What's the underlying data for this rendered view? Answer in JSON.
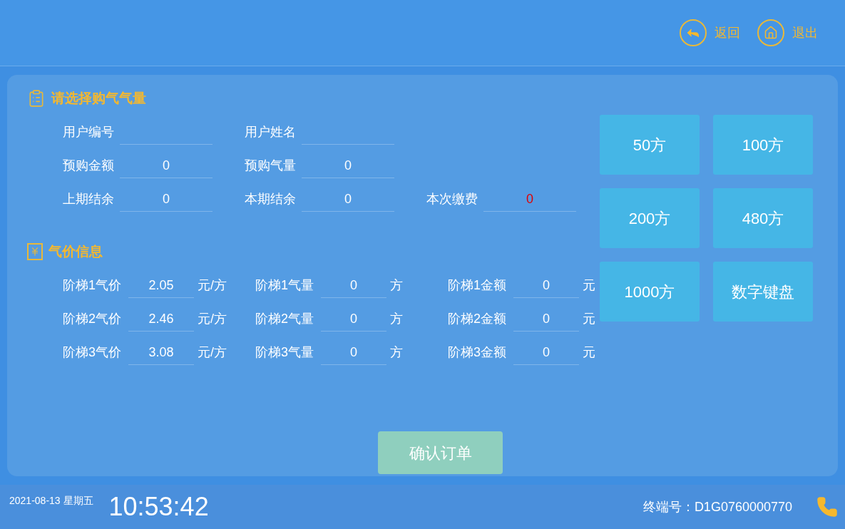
{
  "header": {
    "actions": [
      {
        "kind": "back",
        "label": "返回"
      },
      {
        "kind": "home",
        "label": "退出"
      }
    ]
  },
  "purchase": {
    "title": "请选择购气气量",
    "rows": [
      [
        {
          "label": "用户编号"
        },
        {
          "label": "用户姓名"
        }
      ],
      [
        {
          "label": "预购金额",
          "value": "0",
          "alert": false
        },
        {
          "label": "预购气量",
          "value": "0",
          "alert": false
        }
      ],
      [
        {
          "label": "上期结余",
          "value": "0",
          "alert": false
        },
        {
          "label": "本期结余",
          "value": "0",
          "alert": false
        },
        {
          "label": "本次缴费",
          "value": "0",
          "alert": true
        }
      ]
    ]
  },
  "price_info": {
    "title": "气价信息",
    "rows": [
      [
        {
          "label": "阶梯1气价",
          "value": "2.05",
          "unit": "元/方"
        },
        {
          "label": "阶梯1气量",
          "value": "0",
          "unit": "方"
        },
        {
          "label": "阶梯1金额",
          "value": "0",
          "unit": "元"
        }
      ],
      [
        {
          "label": "阶梯2气价",
          "value": "2.46",
          "unit": "元/方"
        },
        {
          "label": "阶梯2气量",
          "value": "0",
          "unit": "方"
        },
        {
          "label": "阶梯2金额",
          "value": "0",
          "unit": "元"
        }
      ],
      [
        {
          "label": "阶梯3气价",
          "value": "3.08",
          "unit": "元/方"
        },
        {
          "label": "阶梯3气量",
          "value": "0",
          "unit": "方"
        },
        {
          "label": "阶梯3金额",
          "value": "0",
          "unit": "元"
        }
      ]
    ]
  },
  "quick_amounts": [
    "50方",
    "100方",
    "200方",
    "480方",
    "1000方",
    "数字键盘"
  ],
  "confirm_button": "确认订单",
  "footer": {
    "date": "2021-08-13",
    "weekday": "星期五",
    "time": "10:53:42",
    "terminal_label": "终端号：",
    "terminal_id": "D1G0760000770"
  }
}
